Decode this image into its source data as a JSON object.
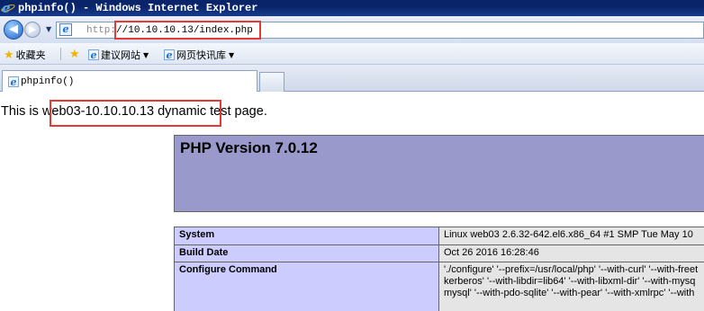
{
  "window": {
    "title": "phpinfo() - Windows Internet Explorer"
  },
  "address": {
    "protocol": "http:",
    "url": "//10.10.10.13/index.php"
  },
  "favorites": {
    "label": "收藏夹",
    "items": [
      {
        "label": "建议网站"
      },
      {
        "label": "网页快讯库"
      }
    ]
  },
  "tabs": [
    {
      "label": "phpinfo()"
    }
  ],
  "page": {
    "intro_prefix": "This is",
    "intro_highlight": "web03-10.10.10.13 dynamic",
    "intro_suffix": "test page.",
    "php_version": "PHP Version 7.0.12",
    "rows": [
      {
        "key": "System",
        "value": [
          "Linux web03 2.6.32-642.el6.x86_64 #1 SMP Tue May 10"
        ]
      },
      {
        "key": "Build Date",
        "value": [
          "Oct 26 2016 16:28:46"
        ]
      },
      {
        "key": "Configure Command",
        "value": [
          "'./configure' '--prefix=/usr/local/php' '--with-curl' '--with-freet",
          "kerberos' '--with-libdir=lib64' '--with-libxml-dir' '--with-mysq",
          "mysql' '--with-pdo-sqlite' '--with-pear' '--with-xmlrpc' '--with"
        ]
      }
    ]
  },
  "colors": {
    "title_bar": "#0a246a",
    "php_header": "#9999cc",
    "table_key": "#ccccff",
    "table_value": "#e5e5e5",
    "highlight_box": "#e53935"
  }
}
